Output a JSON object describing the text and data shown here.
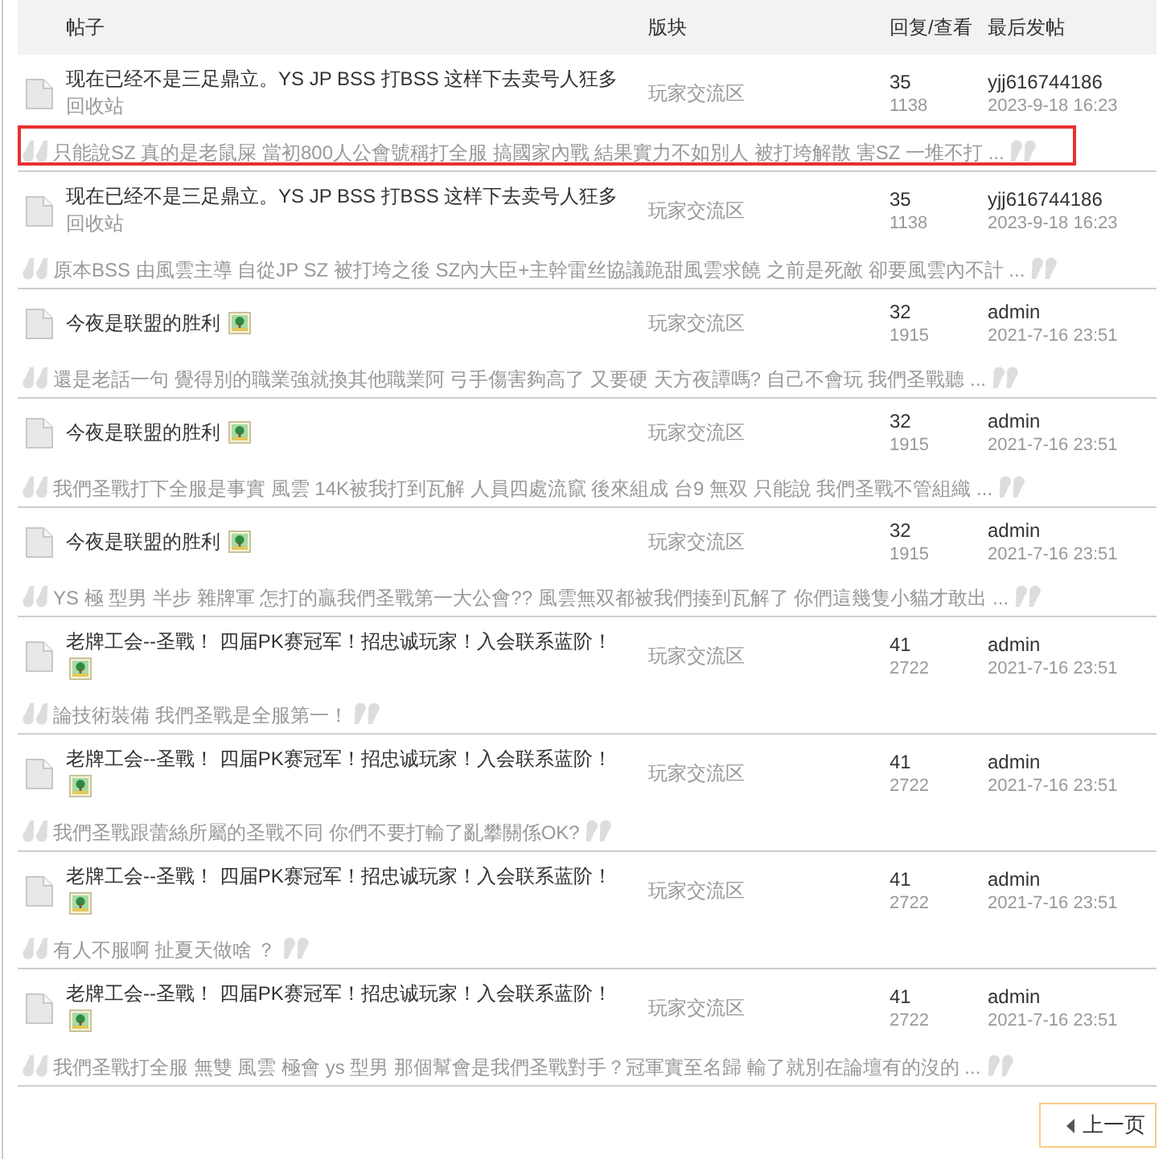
{
  "table": {
    "columns": [
      "帖子",
      "版块",
      "回复/查看",
      "最后发帖"
    ],
    "posts": [
      {
        "title": "现在已经不是三足鼎立。YS JP BSS 打BSS 这样下去卖号人狂多",
        "has_picture": false,
        "sub_label": "回收站",
        "forum": "玩家交流区",
        "replies": "35",
        "views": "1138",
        "last_poster": "yjj616744186",
        "last_post_time": "2023-9-18 16:23",
        "excerpt": "只能說SZ 真的是老鼠屎 當初800人公會號稱打全服 搞國家內戰 結果實力不如別人 被打垮解散 害SZ 一堆不打 ...",
        "highlighted": true
      },
      {
        "title": "现在已经不是三足鼎立。YS JP BSS 打BSS 这样下去卖号人狂多",
        "has_picture": false,
        "sub_label": "回收站",
        "forum": "玩家交流区",
        "replies": "35",
        "views": "1138",
        "last_poster": "yjj616744186",
        "last_post_time": "2023-9-18 16:23",
        "excerpt": "原本BSS 由風雲主導 自從JP SZ 被打垮之後 SZ內大臣+主幹雷丝協議跪甜風雲求饒 之前是死敵 卻要風雲內不計 ...",
        "highlighted": false
      },
      {
        "title": "今夜是联盟的胜利",
        "has_picture": true,
        "forum": "玩家交流区",
        "replies": "32",
        "views": "1915",
        "last_poster": "admin",
        "last_post_time": "2021-7-16 23:51",
        "excerpt": "還是老話一句 覺得別的職業強就換其他職業阿 弓手傷害夠高了 又要硬 天方夜譚嗎? 自己不會玩 我們圣戰聽 ...",
        "highlighted": false
      },
      {
        "title": "今夜是联盟的胜利",
        "has_picture": true,
        "forum": "玩家交流区",
        "replies": "32",
        "views": "1915",
        "last_poster": "admin",
        "last_post_time": "2021-7-16 23:51",
        "excerpt": "我們圣戰打下全服是事實 風雲 14K被我打到瓦解 人員四處流竄 後來組成 台9 無双 只能說 我們圣戰不管組織 ...",
        "highlighted": false
      },
      {
        "title": "今夜是联盟的胜利",
        "has_picture": true,
        "forum": "玩家交流区",
        "replies": "32",
        "views": "1915",
        "last_poster": "admin",
        "last_post_time": "2021-7-16 23:51",
        "excerpt": "YS 極 型男 半步 雜牌軍 怎打的贏我們圣戰第一大公會?? 風雲無双都被我們揍到瓦解了 你們這幾隻小貓才敢出 ...",
        "highlighted": false
      },
      {
        "title": "老牌工会--圣戰！ 四届PK赛冠军！招忠诚玩家！入会联系蓝阶！",
        "has_picture": true,
        "forum": "玩家交流区",
        "replies": "41",
        "views": "2722",
        "last_poster": "admin",
        "last_post_time": "2021-7-16 23:51",
        "excerpt": "論技術裝備 我們圣戰是全服第一！",
        "highlighted": false
      },
      {
        "title": "老牌工会--圣戰！ 四届PK赛冠军！招忠诚玩家！入会联系蓝阶！",
        "has_picture": true,
        "forum": "玩家交流区",
        "replies": "41",
        "views": "2722",
        "last_poster": "admin",
        "last_post_time": "2021-7-16 23:51",
        "excerpt": "我們圣戰跟蕾絲所屬的圣戰不同 你們不要打輸了亂攀關係OK?",
        "highlighted": false
      },
      {
        "title": "老牌工会--圣戰！ 四届PK赛冠军！招忠诚玩家！入会联系蓝阶！",
        "has_picture": true,
        "forum": "玩家交流区",
        "replies": "41",
        "views": "2722",
        "last_poster": "admin",
        "last_post_time": "2021-7-16 23:51",
        "excerpt": "有人不服啊 扯夏天做啥 ？",
        "highlighted": false
      },
      {
        "title": "老牌工会--圣戰！ 四届PK赛冠军！招忠诚玩家！入会联系蓝阶！",
        "has_picture": true,
        "forum": "玩家交流区",
        "replies": "41",
        "views": "2722",
        "last_poster": "admin",
        "last_post_time": "2021-7-16 23:51",
        "excerpt": "我們圣戰打全服 無雙 風雲 極會 ys 型男 那個幫會是我們圣戰對手？冠軍實至名歸 輸了就別在論壇有的沒的 ...",
        "highlighted": false
      }
    ]
  },
  "pagination": {
    "prev_label": "上一页"
  }
}
